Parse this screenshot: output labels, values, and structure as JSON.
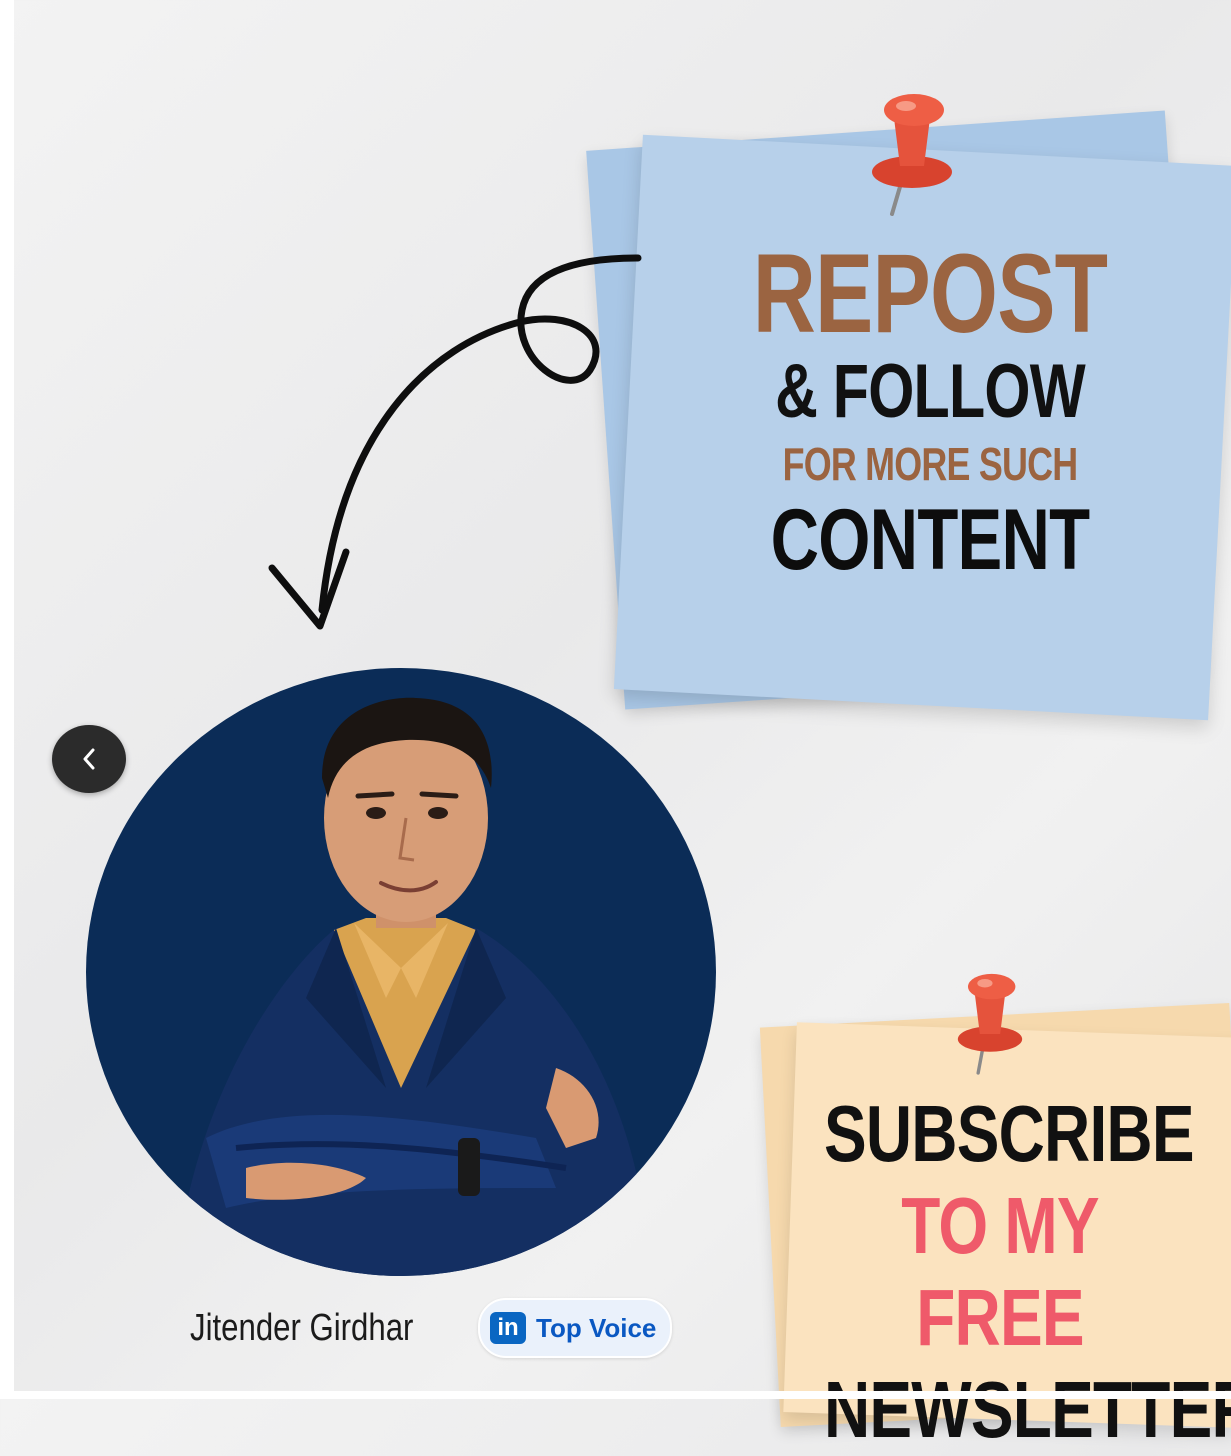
{
  "post": {
    "cta": {
      "line1": "REPOST",
      "line2": "& FOLLOW",
      "line3": "FOR MORE SUCH",
      "line4": "CONTENT"
    },
    "newsletter": {
      "line1": "SUBSCRIBE",
      "line2": "TO MY FREE",
      "line3": "NEWSLETTER"
    },
    "author": {
      "name": "Jitender Girdhar",
      "badge_label": "Top Voice",
      "badge_logo_text": "in"
    },
    "nav": {
      "prev_symbol": "‹"
    },
    "colors": {
      "brown": "#9b6441",
      "pink": "#ef5a6a",
      "blue_note": "#b7d0ea",
      "peach_note": "#fbe3bf",
      "avatar_bg": "#0b2c57",
      "linkedin_blue": "#0a66c2"
    },
    "icons": [
      "pushpin-icon",
      "curly-arrow-icon",
      "chevron-left-icon",
      "linkedin-icon"
    ]
  }
}
